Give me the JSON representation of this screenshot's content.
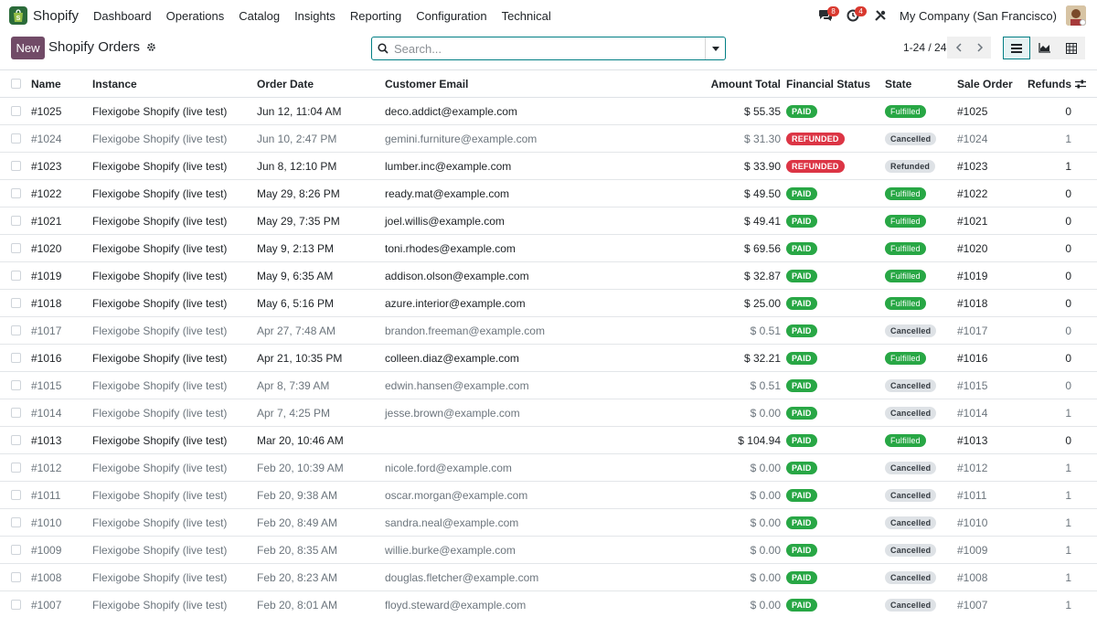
{
  "navbar": {
    "app_name": "Shopify",
    "menu": [
      "Dashboard",
      "Operations",
      "Catalog",
      "Insights",
      "Reporting",
      "Configuration",
      "Technical"
    ],
    "messages_count": "8",
    "activity_count": "4",
    "company": "My Company (San Francisco)"
  },
  "control": {
    "new_label": "New",
    "title": "Shopify Orders",
    "search_placeholder": "Search...",
    "pager": "1-24 / 24"
  },
  "colors": {
    "brand": "#714b67",
    "accent": "#017e84",
    "paid": "#28a745",
    "refunded": "#dc3545"
  },
  "columns": {
    "name": "Name",
    "instance": "Instance",
    "order_date": "Order Date",
    "customer_email": "Customer Email",
    "amount_total": "Amount Total",
    "financial_status": "Financial Status",
    "state": "State",
    "sale_order": "Sale Order",
    "refunds": "Refunds"
  },
  "rows": [
    {
      "name": "#1025",
      "instance": "Flexigobe Shopify (live test)",
      "date": "Jun 12, 11:04 AM",
      "email": "deco.addict@example.com",
      "amount": "$ 55.35",
      "financial": "PAID",
      "state": "Fulfilled",
      "sale": "#1025",
      "refunds": "0",
      "muted": false
    },
    {
      "name": "#1024",
      "instance": "Flexigobe Shopify (live test)",
      "date": "Jun 10, 2:47 PM",
      "email": "gemini.furniture@example.com",
      "amount": "$ 31.30",
      "financial": "REFUNDED",
      "state": "Cancelled",
      "sale": "#1024",
      "refunds": "1",
      "muted": true
    },
    {
      "name": "#1023",
      "instance": "Flexigobe Shopify (live test)",
      "date": "Jun 8, 12:10 PM",
      "email": "lumber.inc@example.com",
      "amount": "$ 33.90",
      "financial": "REFUNDED",
      "state": "Refunded",
      "sale": "#1023",
      "refunds": "1",
      "muted": false
    },
    {
      "name": "#1022",
      "instance": "Flexigobe Shopify (live test)",
      "date": "May 29, 8:26 PM",
      "email": "ready.mat@example.com",
      "amount": "$ 49.50",
      "financial": "PAID",
      "state": "Fulfilled",
      "sale": "#1022",
      "refunds": "0",
      "muted": false
    },
    {
      "name": "#1021",
      "instance": "Flexigobe Shopify (live test)",
      "date": "May 29, 7:35 PM",
      "email": "joel.willis@example.com",
      "amount": "$ 49.41",
      "financial": "PAID",
      "state": "Fulfilled",
      "sale": "#1021",
      "refunds": "0",
      "muted": false
    },
    {
      "name": "#1020",
      "instance": "Flexigobe Shopify (live test)",
      "date": "May 9, 2:13 PM",
      "email": "toni.rhodes@example.com",
      "amount": "$ 69.56",
      "financial": "PAID",
      "state": "Fulfilled",
      "sale": "#1020",
      "refunds": "0",
      "muted": false
    },
    {
      "name": "#1019",
      "instance": "Flexigobe Shopify (live test)",
      "date": "May 9, 6:35 AM",
      "email": "addison.olson@example.com",
      "amount": "$ 32.87",
      "financial": "PAID",
      "state": "Fulfilled",
      "sale": "#1019",
      "refunds": "0",
      "muted": false
    },
    {
      "name": "#1018",
      "instance": "Flexigobe Shopify (live test)",
      "date": "May 6, 5:16 PM",
      "email": "azure.interior@example.com",
      "amount": "$ 25.00",
      "financial": "PAID",
      "state": "Fulfilled",
      "sale": "#1018",
      "refunds": "0",
      "muted": false
    },
    {
      "name": "#1017",
      "instance": "Flexigobe Shopify (live test)",
      "date": "Apr 27, 7:48 AM",
      "email": "brandon.freeman@example.com",
      "amount": "$ 0.51",
      "financial": "PAID",
      "state": "Cancelled",
      "sale": "#1017",
      "refunds": "0",
      "muted": true
    },
    {
      "name": "#1016",
      "instance": "Flexigobe Shopify (live test)",
      "date": "Apr 21, 10:35 PM",
      "email": "colleen.diaz@example.com",
      "amount": "$ 32.21",
      "financial": "PAID",
      "state": "Fulfilled",
      "sale": "#1016",
      "refunds": "0",
      "muted": false
    },
    {
      "name": "#1015",
      "instance": "Flexigobe Shopify (live test)",
      "date": "Apr 8, 7:39 AM",
      "email": "edwin.hansen@example.com",
      "amount": "$ 0.51",
      "financial": "PAID",
      "state": "Cancelled",
      "sale": "#1015",
      "refunds": "0",
      "muted": true
    },
    {
      "name": "#1014",
      "instance": "Flexigobe Shopify (live test)",
      "date": "Apr 7, 4:25 PM",
      "email": "jesse.brown@example.com",
      "amount": "$ 0.00",
      "financial": "PAID",
      "state": "Cancelled",
      "sale": "#1014",
      "refunds": "1",
      "muted": true
    },
    {
      "name": "#1013",
      "instance": "Flexigobe Shopify (live test)",
      "date": "Mar 20, 10:46 AM",
      "email": "",
      "amount": "$ 104.94",
      "financial": "PAID",
      "state": "Fulfilled",
      "sale": "#1013",
      "refunds": "0",
      "muted": false
    },
    {
      "name": "#1012",
      "instance": "Flexigobe Shopify (live test)",
      "date": "Feb 20, 10:39 AM",
      "email": "nicole.ford@example.com",
      "amount": "$ 0.00",
      "financial": "PAID",
      "state": "Cancelled",
      "sale": "#1012",
      "refunds": "1",
      "muted": true
    },
    {
      "name": "#1011",
      "instance": "Flexigobe Shopify (live test)",
      "date": "Feb 20, 9:38 AM",
      "email": "oscar.morgan@example.com",
      "amount": "$ 0.00",
      "financial": "PAID",
      "state": "Cancelled",
      "sale": "#1011",
      "refunds": "1",
      "muted": true
    },
    {
      "name": "#1010",
      "instance": "Flexigobe Shopify (live test)",
      "date": "Feb 20, 8:49 AM",
      "email": "sandra.neal@example.com",
      "amount": "$ 0.00",
      "financial": "PAID",
      "state": "Cancelled",
      "sale": "#1010",
      "refunds": "1",
      "muted": true
    },
    {
      "name": "#1009",
      "instance": "Flexigobe Shopify (live test)",
      "date": "Feb 20, 8:35 AM",
      "email": "willie.burke@example.com",
      "amount": "$ 0.00",
      "financial": "PAID",
      "state": "Cancelled",
      "sale": "#1009",
      "refunds": "1",
      "muted": true
    },
    {
      "name": "#1008",
      "instance": "Flexigobe Shopify (live test)",
      "date": "Feb 20, 8:23 AM",
      "email": "douglas.fletcher@example.com",
      "amount": "$ 0.00",
      "financial": "PAID",
      "state": "Cancelled",
      "sale": "#1008",
      "refunds": "1",
      "muted": true
    },
    {
      "name": "#1007",
      "instance": "Flexigobe Shopify (live test)",
      "date": "Feb 20, 8:01 AM",
      "email": "floyd.steward@example.com",
      "amount": "$ 0.00",
      "financial": "PAID",
      "state": "Cancelled",
      "sale": "#1007",
      "refunds": "1",
      "muted": true
    }
  ]
}
